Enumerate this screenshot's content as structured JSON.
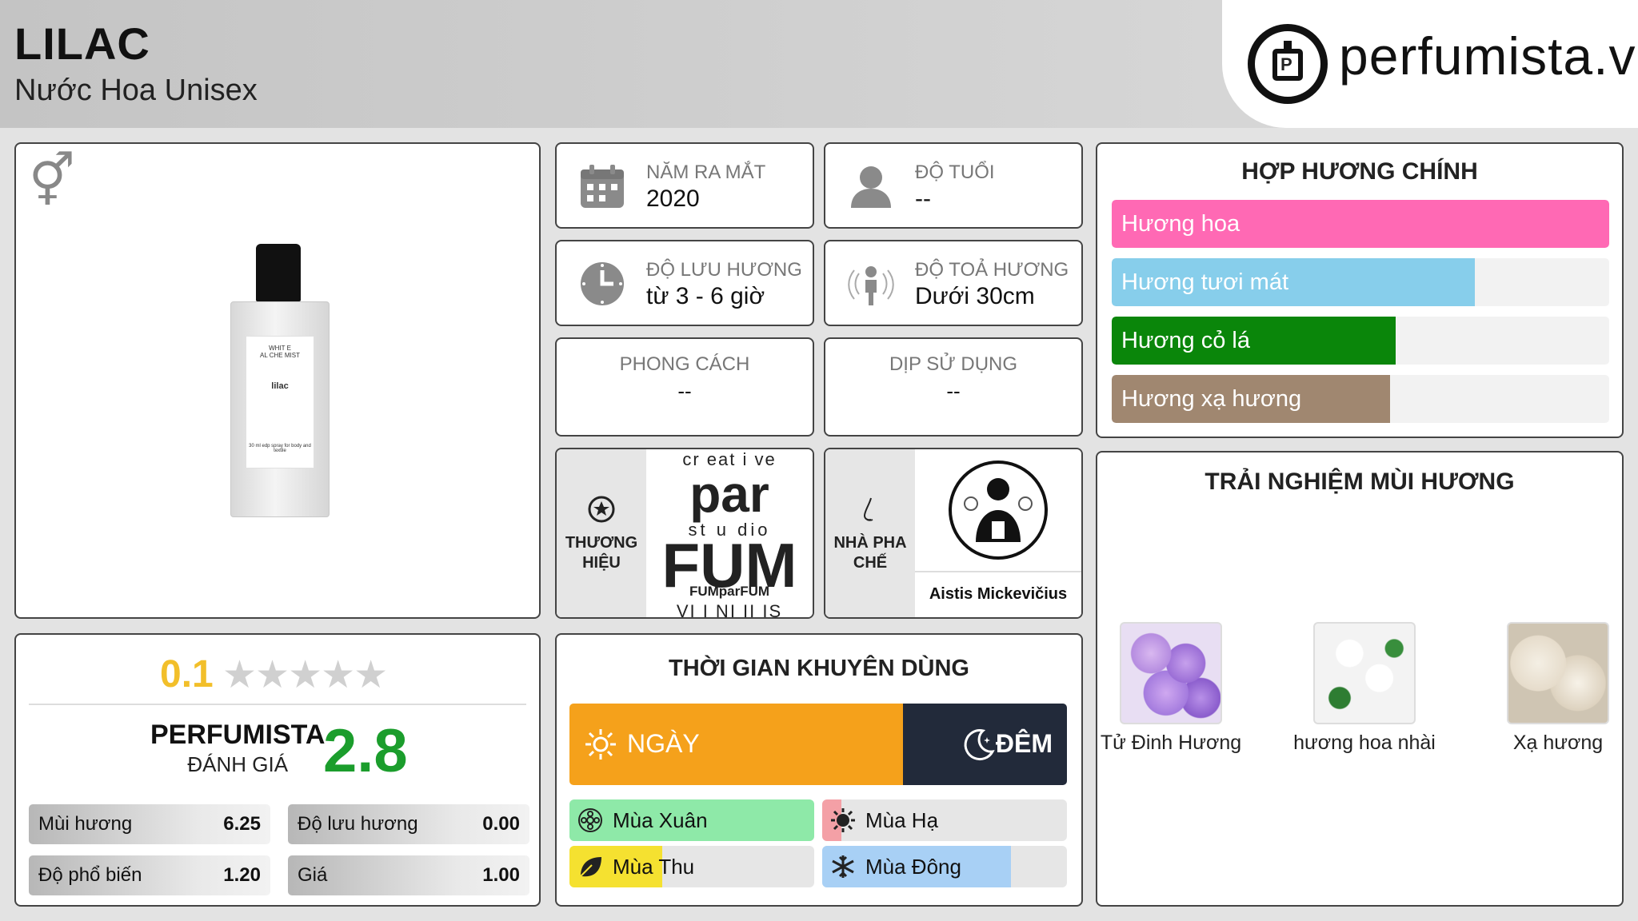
{
  "header": {
    "title": "LILAC",
    "subtitle": "Nước Hoa Unisex",
    "logo_text": "perfumista.vn",
    "logo_mark": "P"
  },
  "product": {
    "gender_icon": "unisex-gender-icon",
    "bottle": {
      "brand_line1": "WHIT E",
      "brand_line2": "AL CHE MIST",
      "name": "lilac",
      "small_text": "30 ml edp spray for body and textile"
    }
  },
  "info": {
    "year": {
      "label": "NĂM RA MẮT",
      "value": "2020",
      "icon": "calendar-icon"
    },
    "age": {
      "label": "ĐỘ TUỔI",
      "value": "--",
      "icon": "user-icon"
    },
    "longevity": {
      "label": "ĐỘ LƯU HƯƠNG",
      "value": "từ 3 - 6 giờ",
      "icon": "clock-icon"
    },
    "sillage": {
      "label": "ĐỘ TOẢ HƯƠNG",
      "value": "Dưới 30cm",
      "icon": "sillage-icon"
    },
    "style": {
      "label": "PHONG CÁCH",
      "value": "--"
    },
    "occasion": {
      "label": "DỊP SỬ DỤNG",
      "value": "--"
    }
  },
  "brand": {
    "label_1": "THƯƠNG",
    "label_2": "HIỆU",
    "logo_line1": "cr eat i ve",
    "logo_line2": "par",
    "logo_line3": "st u dio",
    "logo_line4": "FUM",
    "caption": "FUMparFUM",
    "logo_bottom": "VI I NI II IS"
  },
  "perfumer": {
    "label_1": "NHÀ PHA",
    "label_2": "CHẾ",
    "name": "Aistis Mickevičius"
  },
  "accords": {
    "title": "HỢP HƯƠNG CHÍNH",
    "items": [
      {
        "label": "Hương hoa",
        "percent": 100,
        "color": "#ff69b4"
      },
      {
        "label": "Hương tươi mát",
        "percent": 73,
        "color": "#87ceeb"
      },
      {
        "label": "Hương cỏ lá",
        "percent": 57,
        "color": "#0a860a"
      },
      {
        "label": "Hương xạ hương",
        "percent": 56,
        "color": "#a08770"
      }
    ]
  },
  "notes": {
    "title": "TRẢI NGHIỆM MÙI HƯƠNG",
    "items": [
      {
        "label": "Tử Đinh Hương",
        "icon": "lilac-flower-image"
      },
      {
        "label": "hương hoa nhài",
        "icon": "jasmine-flower-image"
      },
      {
        "label": "Xạ hương",
        "icon": "musk-image"
      }
    ]
  },
  "rating": {
    "user_score": "0.1",
    "stars_total": 5,
    "stars_value": 0.1,
    "perfumista_label": "PERFUMISTA",
    "perfumista_sub": "ĐÁNH GIÁ",
    "perfumista_score": "2.8",
    "metrics": [
      {
        "label": "Mùi hương",
        "value": "6.25"
      },
      {
        "label": "Độ lưu hương",
        "value": "0.00"
      },
      {
        "label": "Độ phổ biến",
        "value": "1.20"
      },
      {
        "label": "Giá",
        "value": "1.00"
      }
    ]
  },
  "usage": {
    "title": "THỜI GIAN KHUYÊN DÙNG",
    "day_label": "NGÀY",
    "night_label": "ĐÊM",
    "day_percent": 67,
    "seasons": [
      {
        "label": "Mùa Xuân",
        "percent": 100,
        "color": "#8ee9a8",
        "icon": "flower-icon"
      },
      {
        "label": "Mùa Hạ",
        "percent": 8,
        "color": "#f4a0a6",
        "icon": "sun-icon"
      },
      {
        "label": "Mùa Thu",
        "percent": 38,
        "color": "#f5e130",
        "icon": "leaf-icon"
      },
      {
        "label": "Mùa Đông",
        "percent": 77,
        "color": "#a8d0f5",
        "icon": "snowflake-icon"
      }
    ]
  }
}
